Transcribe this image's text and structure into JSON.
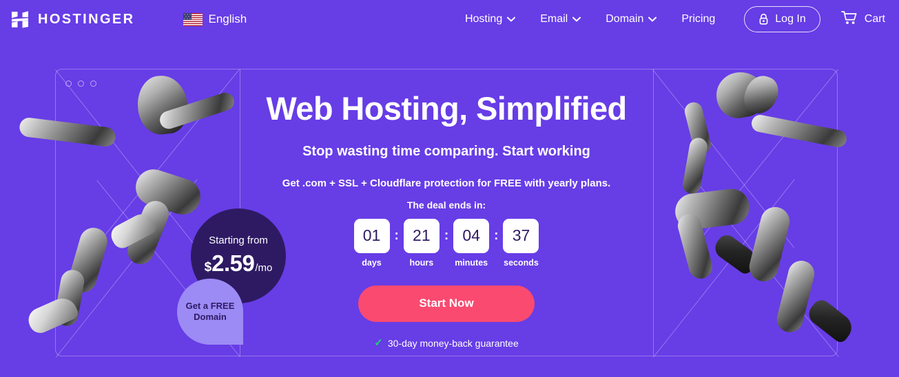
{
  "theme": {
    "background_purple": "#673DE6",
    "dark_badge_purple": "#2E1A63",
    "light_badge_purple": "#9C8BF5",
    "cta_pink": "#FA4A70",
    "check_green": "#25D07A",
    "white": "#FFFFFF"
  },
  "header": {
    "brand_name": "HOSTINGER",
    "logo_icon": "hostinger-h-logo",
    "language": {
      "label": "English",
      "flag_icon": "us-flag-icon"
    },
    "nav_items": [
      {
        "label": "Hosting",
        "has_dropdown": true,
        "icon": "chevron-down-icon"
      },
      {
        "label": "Email",
        "has_dropdown": true,
        "icon": "chevron-down-icon"
      },
      {
        "label": "Domain",
        "has_dropdown": true,
        "icon": "chevron-down-icon"
      },
      {
        "label": "Pricing",
        "has_dropdown": false,
        "icon": ""
      }
    ],
    "login": {
      "label": "Log In",
      "icon": "lock-icon"
    },
    "cart": {
      "label": "Cart",
      "icon": "shopping-cart-icon"
    }
  },
  "hero": {
    "headline": "Web Hosting, Simplified",
    "subheadline": "Stop wasting time comparing. Start working",
    "description": "Get .com + SSL + Cloudflare protection for FREE with yearly plans.",
    "deal_label": "The deal ends in:",
    "countdown": {
      "separator": ":",
      "units": [
        {
          "value": "01",
          "label": "days"
        },
        {
          "value": "21",
          "label": "hours"
        },
        {
          "value": "04",
          "label": "minutes"
        },
        {
          "value": "37",
          "label": "seconds"
        }
      ]
    },
    "cta_label": "Start Now",
    "guarantee": {
      "icon": "check-icon",
      "text": "30-day money-back guarantee"
    },
    "price_badge": {
      "starting_from": "Starting from",
      "currency": "$",
      "amount": "2.59",
      "period": "/mo"
    },
    "free_domain_badge": {
      "text": "Get a FREE\nDomain"
    },
    "decor": {
      "window_dots_icon": "window-traffic-lights-icon",
      "left_figure": "running-man-collage",
      "right_figure": "running-woman-collage"
    }
  }
}
